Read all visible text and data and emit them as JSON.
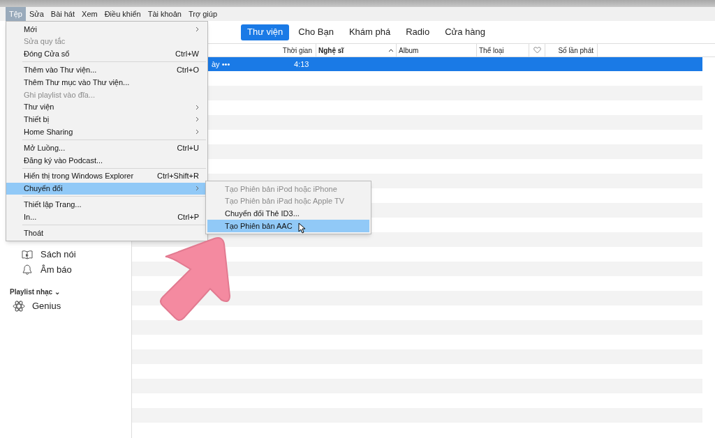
{
  "menu_bar": [
    {
      "label": "Tệp",
      "selected": true
    },
    {
      "label": "Sửa",
      "selected": false
    },
    {
      "label": "Bài hát",
      "selected": false
    },
    {
      "label": "Xem",
      "selected": false
    },
    {
      "label": "Điều khiển",
      "selected": false
    },
    {
      "label": "Tài khoản",
      "selected": false
    },
    {
      "label": "Trợ giúp",
      "selected": false
    }
  ],
  "file_menu": [
    [
      {
        "label": "Mới",
        "submenu": true,
        "disabled": false,
        "selected": false
      },
      {
        "label": "Sửa quy tắc",
        "disabled": true,
        "selected": false
      },
      {
        "label": "Đóng Cửa sổ",
        "shortcut": "Ctrl+W",
        "disabled": false,
        "selected": false
      }
    ],
    [
      {
        "label": "Thêm vào Thư viện...",
        "shortcut": "Ctrl+O",
        "disabled": false,
        "selected": false
      },
      {
        "label": "Thêm Thư mục vào Thư viện...",
        "disabled": false,
        "selected": false
      },
      {
        "label": "Ghi playlist vào đĩa...",
        "disabled": true,
        "selected": false
      },
      {
        "label": "Thư viện",
        "submenu": true,
        "disabled": false,
        "selected": false
      },
      {
        "label": "Thiết bị",
        "submenu": true,
        "disabled": false,
        "selected": false
      },
      {
        "label": "Home Sharing",
        "submenu": true,
        "disabled": false,
        "selected": false
      }
    ],
    [
      {
        "label": "Mở Luồng...",
        "shortcut": "Ctrl+U",
        "disabled": false,
        "selected": false
      },
      {
        "label": "Đăng ký vào Podcast...",
        "disabled": false,
        "selected": false
      }
    ],
    [
      {
        "label": "Hiển thị trong Windows Explorer",
        "shortcut": "Ctrl+Shift+R",
        "disabled": false,
        "selected": false
      },
      {
        "label": "Chuyển đổi",
        "submenu": true,
        "disabled": false,
        "selected": true
      }
    ],
    [
      {
        "label": "Thiết lập Trang...",
        "disabled": false,
        "selected": false
      },
      {
        "label": "In...",
        "shortcut": "Ctrl+P",
        "disabled": false,
        "selected": false
      }
    ],
    [
      {
        "label": "Thoát",
        "disabled": false,
        "selected": false
      }
    ]
  ],
  "convert_submenu": [
    {
      "label": "Tạo Phiên bản iPod hoặc iPhone",
      "disabled": true,
      "selected": false
    },
    {
      "label": "Tạo Phiên bản iPad hoặc Apple TV",
      "disabled": true,
      "selected": false
    },
    {
      "label": "Chuyển đổi Thẻ ID3...",
      "disabled": false,
      "selected": false
    },
    {
      "label": "Tạo Phiên bản AAC",
      "disabled": false,
      "selected": true
    }
  ],
  "tabs": [
    {
      "label": "Thư viện",
      "selected": true
    },
    {
      "label": "Cho Bạn",
      "selected": false
    },
    {
      "label": "Khám phá",
      "selected": false
    },
    {
      "label": "Radio",
      "selected": false
    },
    {
      "label": "Cửa hàng",
      "selected": false
    }
  ],
  "sidebar": {
    "items": [
      {
        "label": "Sách nói"
      },
      {
        "label": "Âm báo"
      }
    ],
    "playlist_heading": "Playlist nhạc ⌄",
    "playlists": [
      {
        "label": "Genius"
      }
    ]
  },
  "table": {
    "columns": [
      {
        "label": "Thời gian",
        "kind": "text",
        "sorted": false
      },
      {
        "label": "Nghệ sĩ",
        "kind": "text",
        "sorted": true
      },
      {
        "label": "Album",
        "kind": "text",
        "sorted": false
      },
      {
        "label": "Thể loại",
        "kind": "text",
        "sorted": false
      },
      {
        "kind": "heart"
      },
      {
        "label": "Số lần phát",
        "kind": "text",
        "sorted": false
      }
    ],
    "rows": [
      {
        "title": "ày",
        "more": "•••",
        "time": "4:13",
        "selected": true
      }
    ]
  }
}
